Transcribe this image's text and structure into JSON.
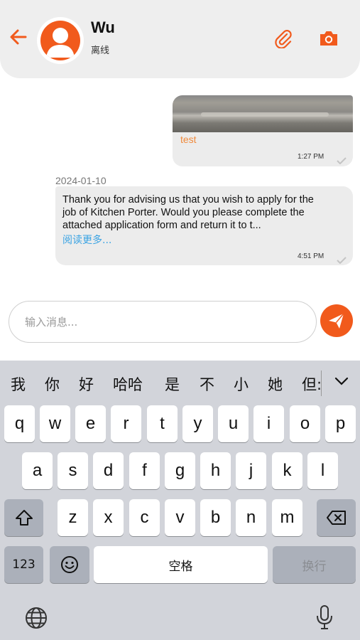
{
  "header": {
    "contact_name": "Wu",
    "contact_status": "离线",
    "icons": [
      "back-arrow-icon",
      "avatar-person-icon",
      "paperclip-icon",
      "camera-icon"
    ],
    "accent_color": "#f15a1c"
  },
  "messages": [
    {
      "direction": "outgoing",
      "type": "image",
      "caption": "test",
      "time": "1:27 PM"
    },
    {
      "direction": "incoming",
      "date": "2024-01-10",
      "text_lines": [
        "Thank you for advising us that you wish to apply for the",
        "job of Kitchen Porter.  Would you please complete the",
        "attached application form and return it to t..."
      ],
      "read_more": "阅读更多...",
      "time": "4:51 PM"
    }
  ],
  "composer": {
    "placeholder": "输入消息...",
    "value": ""
  },
  "keyboard": {
    "candidates": [
      "我",
      "你",
      "好",
      "哈哈",
      "是",
      "不",
      "小",
      "她",
      "但:"
    ],
    "row1": [
      "q",
      "w",
      "e",
      "r",
      "t",
      "y",
      "u",
      "i",
      "o",
      "p"
    ],
    "row2": [
      "a",
      "s",
      "d",
      "f",
      "g",
      "h",
      "j",
      "k",
      "l"
    ],
    "row3": [
      "z",
      "x",
      "c",
      "v",
      "b",
      "n",
      "m"
    ],
    "numbers_label": "123",
    "space_label": "空格",
    "return_label": "换行"
  }
}
